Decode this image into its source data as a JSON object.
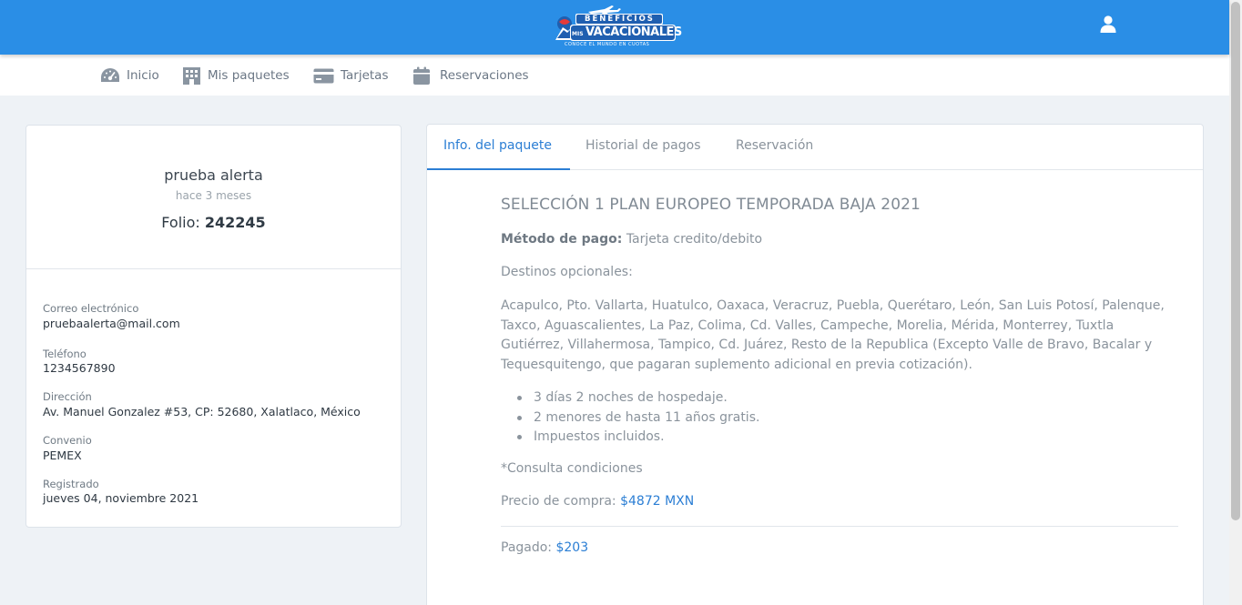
{
  "header": {
    "logo": {
      "line1": "BENEFICIOS",
      "line2": "VACACIONALES",
      "prefix": "MIS",
      "tagline": "CONOCE EL MUNDO EN CUOTAS"
    },
    "user_icon": "user-icon"
  },
  "nav": {
    "items": [
      {
        "label": "Inicio",
        "icon": "dashboard-icon"
      },
      {
        "label": "Mis paquetes",
        "icon": "building-icon"
      },
      {
        "label": "Tarjetas",
        "icon": "credit-card-icon"
      },
      {
        "label": "Reservaciones",
        "icon": "calendar-icon"
      }
    ]
  },
  "profile": {
    "name": "prueba alerta",
    "ago": "hace 3 meses",
    "folio_label": "Folio:",
    "folio_value": "242245",
    "fields": [
      {
        "label": "Correo electrónico",
        "value": "pruebaalerta@mail.com"
      },
      {
        "label": "Teléfono",
        "value": "1234567890"
      },
      {
        "label": "Dirección",
        "value": "Av. Manuel Gonzalez #53, CP: 52680, Xalatlaco, México"
      },
      {
        "label": "Convenio",
        "value": "PEMEX"
      },
      {
        "label": "Registrado",
        "value": "jueves 04, noviembre 2021"
      }
    ]
  },
  "tabs": [
    {
      "label": "Info. del paquete",
      "active": true
    },
    {
      "label": "Historial de pagos",
      "active": false
    },
    {
      "label": "Reservación",
      "active": false
    }
  ],
  "package": {
    "title": "SELECCIÓN 1 PLAN EUROPEO TEMPORADA BAJA 2021",
    "payment_method_label": "Método de pago:",
    "payment_method_value": "Tarjeta credito/debito",
    "destinations_label": "Destinos opcionales:",
    "destinations_text": "Acapulco, Pto. Vallarta, Huatulco, Oaxaca, Veracruz, Puebla, Querétaro, León, San Luis Potosí, Palenque, Taxco, Aguascalientes, La Paz, Colima, Cd. Valles, Campeche, Morelia, Mérida, Monterrey, Tuxtla Gutiérrez, Villahermosa, Tampico, Cd. Juárez, Resto de la Republica (Excepto Valle de Bravo, Bacalar y Tequesquitengo, que pagaran suplemento adicional en previa cotización).",
    "bullets": [
      "3 días 2 noches de hospedaje.",
      "2 menores de hasta 11 años gratis.",
      "Impuestos incluidos."
    ],
    "conditions": "*Consulta condiciones",
    "price_label": "Precio de compra:",
    "price_value": "$4872 MXN",
    "paid_label": "Pagado:",
    "paid_value": "$203"
  },
  "colors": {
    "header_blue": "#2a8ee6",
    "accent": "#2b7ed4",
    "background": "#eef2f6"
  }
}
